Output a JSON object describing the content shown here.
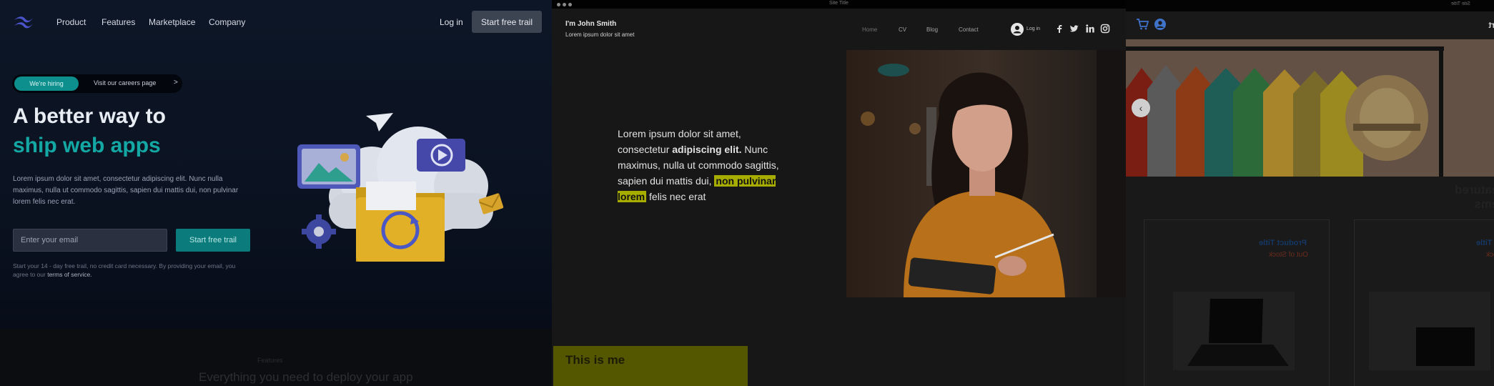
{
  "landing": {
    "nav": [
      "Product",
      "Features",
      "Marketplace",
      "Company"
    ],
    "login": "Log in",
    "cta_top": "Start free trail",
    "badge": "We're hiring",
    "careers_link": "Visit our careers page",
    "careers_arrow": ">",
    "headline_1": "A better way to",
    "headline_2": "ship web apps",
    "lead": "Lorem ipsum dolor sit amet, consectetur adipiscing elit. Nunc nulla maximus, nulla ut commodo sagittis, sapien dui mattis dui, non pulvinar lorem felis nec erat.",
    "email_placeholder": "Enter your email",
    "cta_main": "Start free trail",
    "fine_print": "Start your 14 - day free trail, no credit card necessary. By providing your email, you agree to our",
    "terms": "terms of service.",
    "faint_label": "Features",
    "faint_heading": "Everything you need to deploy your app",
    "colors": {
      "accent": "#14a8a4",
      "background": "#0a0f1d"
    }
  },
  "portfolio": {
    "window_title": "Site Title",
    "name": "I'm John Smith",
    "tagline": "Lorem ipsum dolor sit amet",
    "nav": [
      "Home",
      "CV",
      "Blog",
      "Contact"
    ],
    "login": "Log in",
    "social": [
      "facebook-icon",
      "twitter-icon",
      "linkedin-icon",
      "instagram-icon"
    ],
    "body_1": "Lorem ipsum dolor sit amet, consectetur ",
    "body_bold": "adipiscing elit.",
    "body_2": " Nunc maximus, nulla ut commodo sagittis, sapien dui mattis dui, ",
    "body_highlight": "non pulvinar lorem",
    "body_3": " felis nec erat",
    "section": "This is me",
    "colors": {
      "highlight": "#a6ad00"
    }
  },
  "shop": {
    "window_title": "Site Title",
    "title": "Fake Shopping Cart",
    "carousel_prev": "‹",
    "section_title": "Featured Items",
    "products": [
      {
        "title": "Product Title",
        "stock": "Out of Stock"
      },
      {
        "title": "Product Title",
        "stock": "Out of Stock"
      }
    ]
  }
}
